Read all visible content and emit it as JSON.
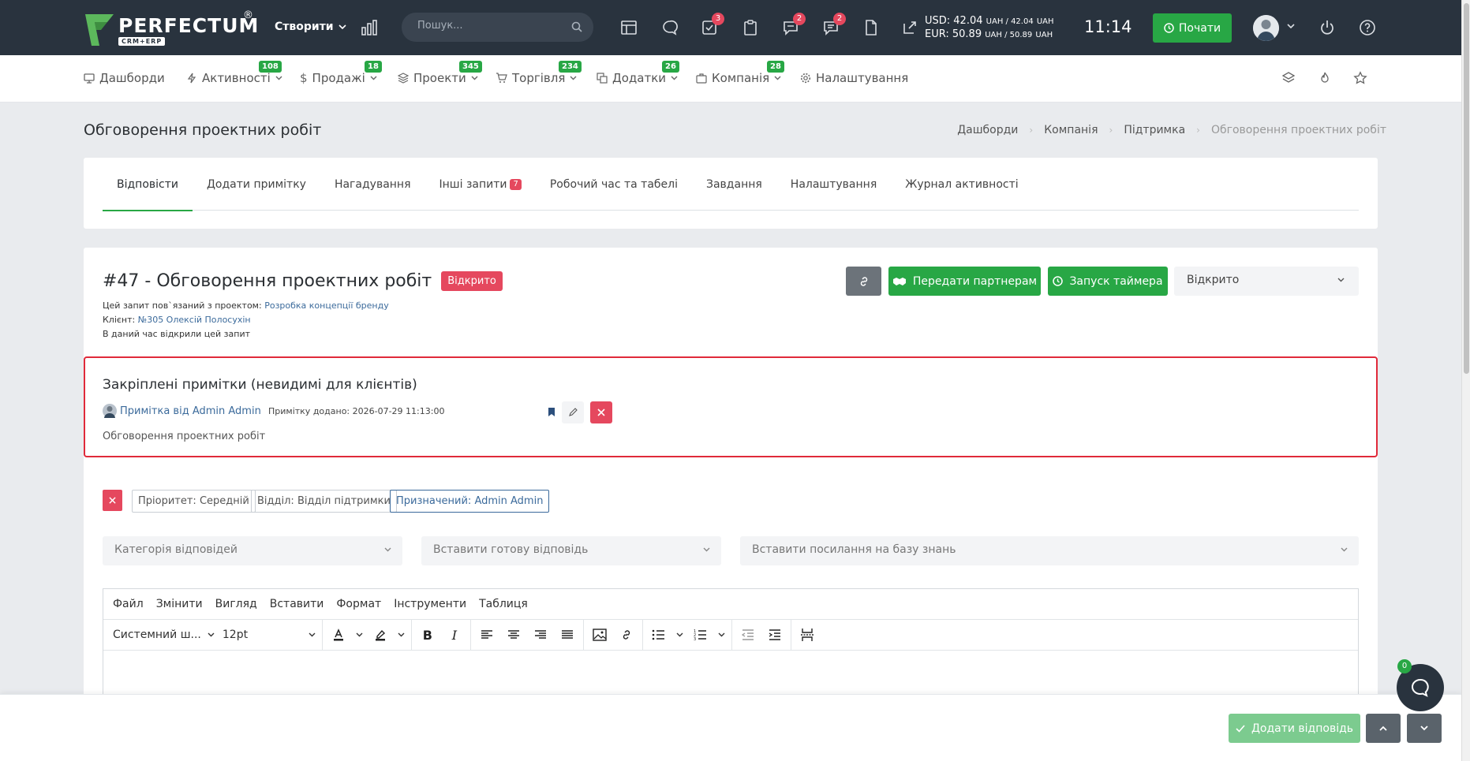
{
  "topbar": {
    "brand": "PERFECTUM",
    "brand_reg": "®",
    "brand_sub": "CRM+ERP",
    "create_label": "Створити",
    "search_placeholder": "Пошук...",
    "badges": {
      "tasks": "3",
      "chat": "2",
      "messages": "2"
    },
    "currency_usd": "USD: 42.04",
    "currency_usd_rest": "UAH / 42.04",
    "currency_eur": "EUR: 50.89",
    "currency_eur_rest": "UAH / 50.89",
    "currency_unit": "UAH",
    "time": "11:14",
    "start_label": "Почати"
  },
  "nav": {
    "items": [
      {
        "label": "Дашборди",
        "badge": ""
      },
      {
        "label": "Активності",
        "badge": "108"
      },
      {
        "label": "Продажі",
        "badge": "18"
      },
      {
        "label": "Проекти",
        "badge": "345"
      },
      {
        "label": "Торгівля",
        "badge": "234"
      },
      {
        "label": "Додатки",
        "badge": "26"
      },
      {
        "label": "Компанія",
        "badge": "28"
      },
      {
        "label": "Налаштування",
        "badge": ""
      }
    ]
  },
  "page": {
    "title": "Обговорення проектних робіт",
    "breadcrumb": [
      "Дашборди",
      "Компанія",
      "Підтримка",
      "Обговорення проектних робіт"
    ]
  },
  "tabs": [
    {
      "label": "Відповісти"
    },
    {
      "label": "Додати примітку"
    },
    {
      "label": "Нагадування"
    },
    {
      "label": "Інші запити",
      "badge": "7"
    },
    {
      "label": "Робочий час та табелі"
    },
    {
      "label": "Завдання"
    },
    {
      "label": "Налаштування"
    },
    {
      "label": "Журнал активності"
    }
  ],
  "ticket": {
    "title": "#47 - Обговорення проектних робіт",
    "status_badge": "Відкрито",
    "project_prefix": "Цей запит пов`язаний з проектом:",
    "project_link": "Розробка концепції бренду",
    "client_prefix": "Клієнт:",
    "client_link": "№305 Олексій Полосухін",
    "viewing": "В даний час відкрили цей запит",
    "share_label": "Передати партнерам",
    "timer_label": "Запуск таймера",
    "status_select": "Відкрито"
  },
  "pinned": {
    "title": "Закріплені примітки (невидимі для клієнтів)",
    "author": "Примітка від Admin Admin",
    "date": "Примітку додано: 2026-07-29 11:13:00",
    "body": "Обговорення проектних робіт"
  },
  "tags": {
    "priority": "Пріоритет: Середній",
    "department": "Відділ: Відділ підтримки",
    "assigned": "Призначений: Admin Admin"
  },
  "selects": {
    "category": "Категорія відповідей",
    "predefined": "Вставити готову відповідь",
    "kb": "Вставити посилання на базу знань"
  },
  "editor": {
    "menu": [
      "Файл",
      "Змінити",
      "Вигляд",
      "Вставити",
      "Формат",
      "Інструменти",
      "Таблиця"
    ],
    "font_family": "Системний ш...",
    "font_size": "12pt"
  },
  "footer": {
    "add_reply": "Додати відповідь"
  },
  "chat": {
    "badge": "0"
  },
  "colors": {
    "topbar": "#29333e",
    "green": "#28a745",
    "red": "#e5485e",
    "link": "#3b6a9b"
  }
}
